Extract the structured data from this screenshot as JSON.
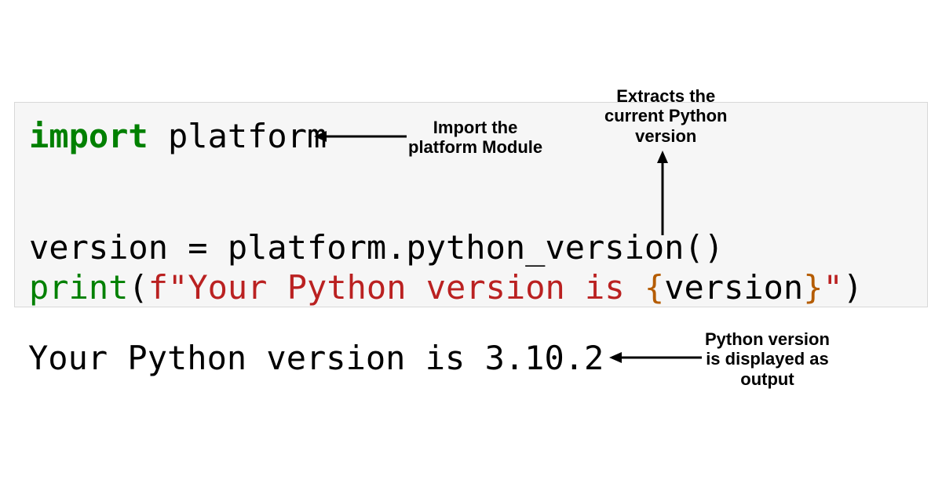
{
  "code": {
    "line1_import": "import",
    "line1_module": " platform",
    "line3_text": "version = platform.python_version()",
    "line4_fn": "print",
    "line4_paren_open": "(",
    "line4_fprefix": "f",
    "line4_quote_open": "\"",
    "line4_str_body": "Your Python version is ",
    "line4_brace_open": "{",
    "line4_var": "version",
    "line4_brace_close": "}",
    "line4_quote_close": "\"",
    "line4_paren_close": ")"
  },
  "output": {
    "text": "Your Python version is 3.10.2"
  },
  "annotations": {
    "import_label": "Import the\nplatform Module",
    "extract_label": "Extracts the\ncurrent Python\nversion",
    "output_label": "Python version\nis displayed as\noutput"
  }
}
